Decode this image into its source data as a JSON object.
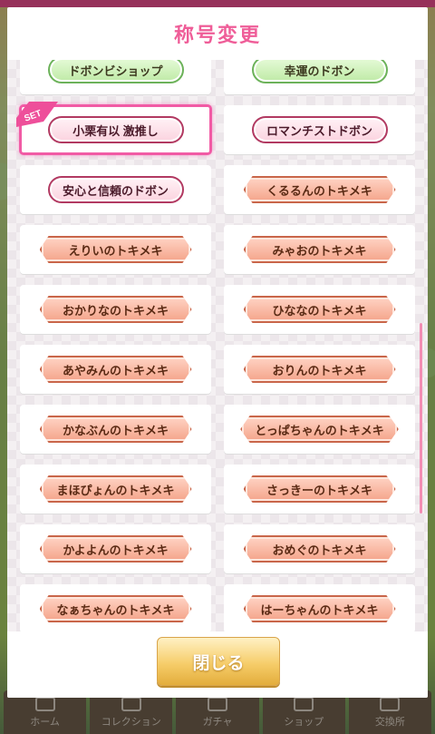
{
  "modal": {
    "title": "称号変更",
    "close_label": "閉じる",
    "set_badge": "SET"
  },
  "titles": [
    {
      "label": "ドボンビショップ",
      "style": "green",
      "selected": false
    },
    {
      "label": "幸運のドボン",
      "style": "green",
      "selected": false
    },
    {
      "label": "小栗有以 激推し",
      "style": "pink",
      "selected": true
    },
    {
      "label": "ロマンチストドボン",
      "style": "pink",
      "selected": false
    },
    {
      "label": "安心と信頼のドボン",
      "style": "pink",
      "selected": false
    },
    {
      "label": "くるるんのトキメキ",
      "style": "orange",
      "selected": false
    },
    {
      "label": "えりいのトキメキ",
      "style": "orange",
      "selected": false
    },
    {
      "label": "みゃおのトキメキ",
      "style": "orange",
      "selected": false
    },
    {
      "label": "おかりなのトキメキ",
      "style": "orange",
      "selected": false
    },
    {
      "label": "ひななのトキメキ",
      "style": "orange",
      "selected": false
    },
    {
      "label": "あやみんのトキメキ",
      "style": "orange",
      "selected": false
    },
    {
      "label": "おりんのトキメキ",
      "style": "orange",
      "selected": false
    },
    {
      "label": "かなぶんのトキメキ",
      "style": "orange",
      "selected": false
    },
    {
      "label": "とっぱちゃんのトキメキ",
      "style": "orange",
      "selected": false
    },
    {
      "label": "まほぴょんのトキメキ",
      "style": "orange",
      "selected": false
    },
    {
      "label": "さっきーのトキメキ",
      "style": "orange",
      "selected": false
    },
    {
      "label": "かよよんのトキメキ",
      "style": "orange",
      "selected": false
    },
    {
      "label": "おめぐのトキメキ",
      "style": "orange",
      "selected": false
    },
    {
      "label": "なぁちゃんのトキメキ",
      "style": "orange",
      "selected": false
    },
    {
      "label": "はーちゃんのトキメキ",
      "style": "orange",
      "selected": false
    }
  ],
  "nav": [
    {
      "label": "ホーム",
      "icon": "home-icon",
      "active": true
    },
    {
      "label": "コレクション",
      "icon": "collection-icon",
      "active": false
    },
    {
      "label": "ガチャ",
      "icon": "gacha-icon",
      "active": false
    },
    {
      "label": "ショップ",
      "icon": "cart-icon",
      "active": false
    },
    {
      "label": "交換所",
      "icon": "exchange-icon",
      "active": false
    }
  ],
  "colors": {
    "title_pink": "#ef5d98",
    "selected_outline": "#f15ba5",
    "close_button": "#f6cd6a"
  }
}
